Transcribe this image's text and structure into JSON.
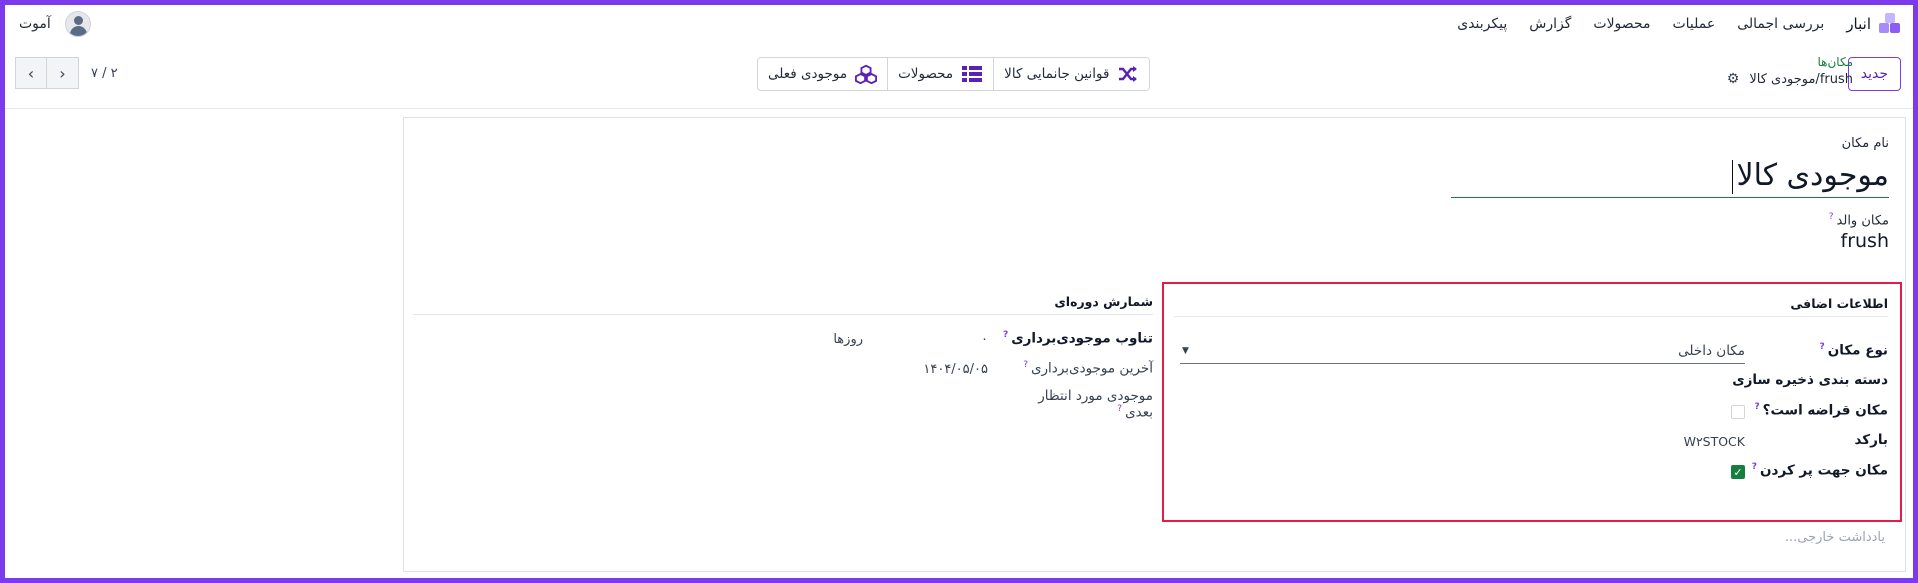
{
  "navbar": {
    "app_name": "انبار",
    "menu": [
      "بررسی اجمالی",
      "عملیات",
      "محصولات",
      "گزارش",
      "پیکربندی"
    ],
    "company": "آموت"
  },
  "control": {
    "new_label": "جدید",
    "breadcrumb_parent": "مکان‌ها",
    "breadcrumb_current": "frush/موجودی کالا",
    "smart_buttons": [
      "قوانین جانمایی کالا",
      "محصولات",
      "موجودی فعلی"
    ],
    "pager": "۷ / ۲"
  },
  "form": {
    "name_label": "نام مکان",
    "name_value": "موجودی کالا",
    "parent_label": "مکان والد",
    "parent_value": "frush",
    "additional": {
      "title": "اطلاعات اضافی",
      "location_type_label": "نوع مکان",
      "location_type_value": "مکان داخلی",
      "storage_category_label": "دسته بندی ذخیره سازی",
      "scrap_label": "مکان قراضه است؟",
      "scrap_checked": false,
      "barcode_label": "بارکد",
      "barcode_value": "W۲STOCK",
      "replenish_label": "مکان جهت پر کردن",
      "replenish_checked": true
    },
    "cyclic": {
      "title": "شمارش دوره‌ای",
      "frequency_label": "تناوب موجودی‌برداری",
      "frequency_value": "۰",
      "frequency_unit": "روزها",
      "last_label": "آخرین موجودی‌برداری",
      "last_value": "۱۴۰۴/۰۵/۰۵",
      "next_label_1": "موجودی مورد انتظار",
      "next_label_2": "بعدی"
    },
    "external_note_placeholder": "یادداشت خارجی..."
  },
  "colors": {
    "accent": "#7c3aed",
    "green": "#15803d",
    "highlight": "#e11d48"
  }
}
